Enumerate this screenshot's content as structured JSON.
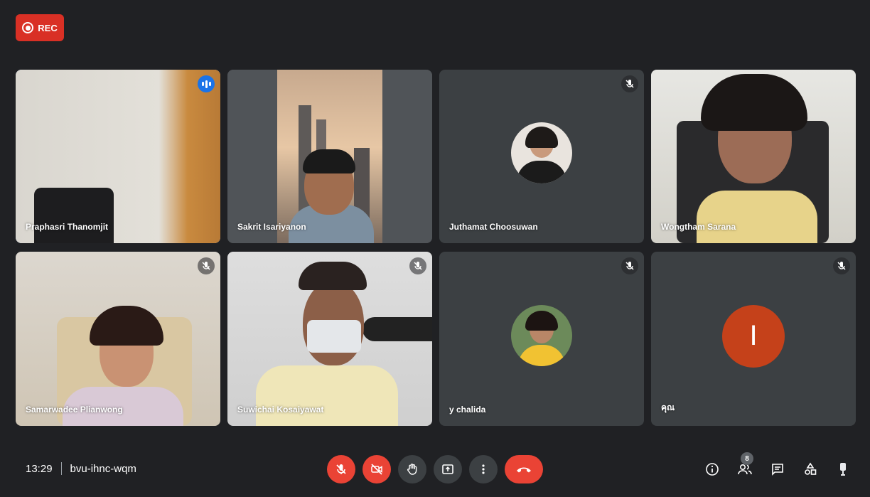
{
  "recording": {
    "label": "REC"
  },
  "participants": [
    {
      "name": "Praphasri Thanomjit",
      "state": "speaking"
    },
    {
      "name": "Sakrit Isariyanon",
      "state": "video"
    },
    {
      "name": "Juthamat Choosuwan",
      "state": "muted-avatar"
    },
    {
      "name": "Wongtham Sarana",
      "state": "video"
    },
    {
      "name": "Samarwadee Plianwong",
      "state": "muted-video"
    },
    {
      "name": "Suwichai Kosaiyawat",
      "state": "muted-video"
    },
    {
      "name": "y chalida",
      "state": "muted-avatar"
    },
    {
      "name": "คุณ",
      "state": "muted-letter",
      "initial": "I"
    }
  ],
  "meeting": {
    "time": "13:29",
    "code": "bvu-ihnc-wqm"
  },
  "toolbar": {
    "buttons": [
      "mic-off-icon",
      "camera-off-icon",
      "raise-hand-icon",
      "present-icon",
      "more-icon",
      "hang-up-icon"
    ]
  },
  "side_controls": {
    "participants_count": "8"
  },
  "colors": {
    "accent": "#1a73e8",
    "danger": "#ea4335",
    "background": "#202124",
    "tile": "#3c4043"
  }
}
